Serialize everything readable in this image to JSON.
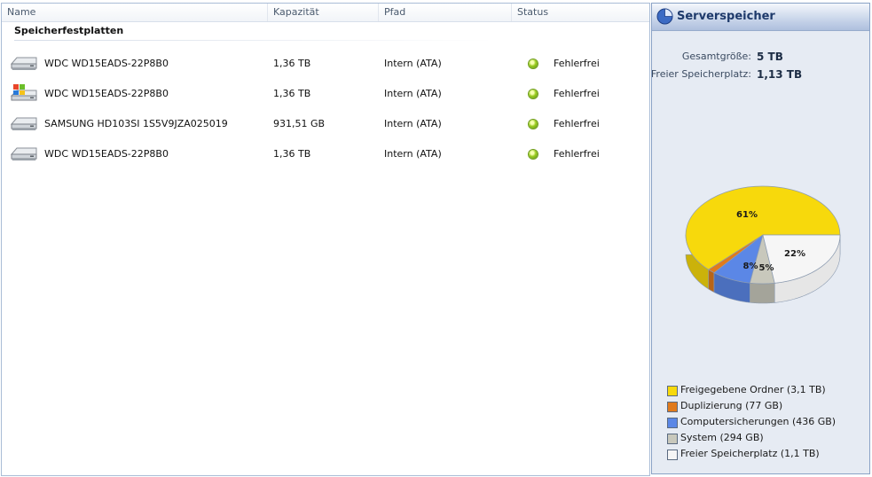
{
  "columns": {
    "name": "Name",
    "capacity": "Kapazität",
    "path": "Pfad",
    "status": "Status"
  },
  "group_title": "Speicherfestplatten",
  "disks": [
    {
      "icon": "hard-drive-icon",
      "name": "WDC WD15EADS-22P8B0",
      "capacity": "1,36 TB",
      "path": "Intern (ATA)",
      "status": "Fehlerfrei"
    },
    {
      "icon": "system-drive-icon",
      "name": "WDC WD15EADS-22P8B0",
      "capacity": "1,36 TB",
      "path": "Intern (ATA)",
      "status": "Fehlerfrei"
    },
    {
      "icon": "hard-drive-icon",
      "name": "SAMSUNG HD103SI 1S5V9JZA025019",
      "capacity": "931,51 GB",
      "path": "Intern (ATA)",
      "status": "Fehlerfrei"
    },
    {
      "icon": "hard-drive-icon",
      "name": "WDC WD15EADS-22P8B0",
      "capacity": "1,36 TB",
      "path": "Intern (ATA)",
      "status": "Fehlerfrei"
    }
  ],
  "panel": {
    "title": "Serverspeicher",
    "total_label": "Gesamtgröße:",
    "total_value": "5 TB",
    "free_label": "Freier Speicherplatz:",
    "free_value": "1,13 TB"
  },
  "chart_data": {
    "type": "pie",
    "slices": [
      {
        "name": "Freigegebene Ordner (3,1 TB)",
        "value": 61,
        "label": "61%",
        "color": "#f7d90c"
      },
      {
        "name": "Duplizierung (77 GB)",
        "value": 1.5,
        "label": "",
        "color": "#e07a1c"
      },
      {
        "name": "Computersicherungen (436 GB)",
        "value": 8,
        "label": "8%",
        "color": "#5b87e6"
      },
      {
        "name": "System (294 GB)",
        "value": 5,
        "label": "5%",
        "color": "#c8c8bc"
      },
      {
        "name": "Freier Speicherplatz (1,1 TB)",
        "value": 22,
        "label": "22%",
        "color": "#f6f6f6"
      }
    ]
  }
}
